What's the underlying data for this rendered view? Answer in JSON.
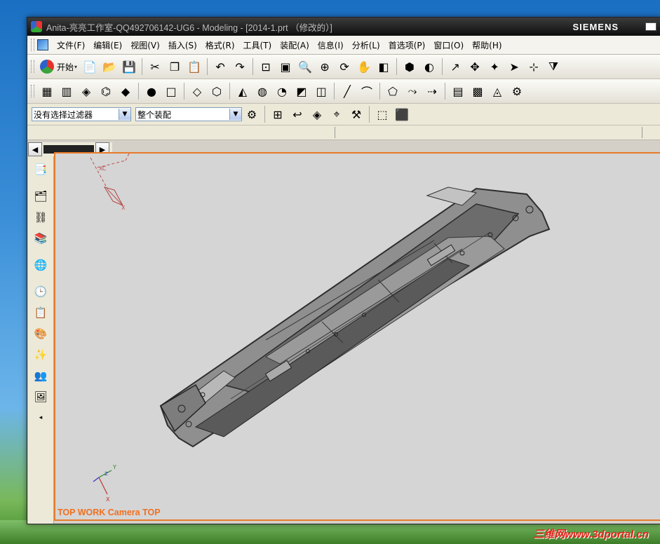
{
  "window": {
    "title": "Anita-亮亮工作室-QQ492706142-UG6 - Modeling - [2014-1.prt （修改的）]",
    "brand": "SIEMENS"
  },
  "menu": [
    {
      "label": "文件(F)"
    },
    {
      "label": "编辑(E)"
    },
    {
      "label": "视图(V)"
    },
    {
      "label": "插入(S)"
    },
    {
      "label": "格式(R)"
    },
    {
      "label": "工具(T)"
    },
    {
      "label": "装配(A)"
    },
    {
      "label": "信息(I)"
    },
    {
      "label": "分析(L)"
    },
    {
      "label": "首选项(P)"
    },
    {
      "label": "窗口(O)"
    },
    {
      "label": "帮助(H)"
    }
  ],
  "toolbar": {
    "start_label": "开始",
    "icons_row1": [
      "new-file-icon",
      "open-folder-icon",
      "save-icon",
      "cut-icon",
      "copy-icon",
      "paste-icon",
      "undo-icon",
      "redo-icon",
      "fit-view-icon",
      "zoom-window-icon",
      "zoom-icon",
      "zoom-in-icon",
      "rotate-icon",
      "pan-icon",
      "perspective-icon",
      "shaded-view-icon",
      "render-style-icon",
      "wcs-icon",
      "move-icon",
      "snap-icon",
      "select-icon",
      "point-icon",
      "filter-icon"
    ],
    "icons_row2": [
      "sketch-icon",
      "datum-plane-icon",
      "extrude-icon",
      "revolve-icon",
      "sweep-icon",
      "hole-icon",
      "boss-icon",
      "block-icon",
      "cylinder-icon",
      "cone-icon",
      "sphere-icon",
      "blend-icon",
      "chamfer-icon",
      "shell-icon",
      "line-icon",
      "arc-icon",
      "spline-icon",
      "curve-icon",
      "offset-icon",
      "surface-icon",
      "mesh-icon",
      "trim-icon",
      "analysis-icon"
    ]
  },
  "filter": {
    "selection_filter": "没有选择过滤器",
    "assembly_scope": "整个装配"
  },
  "resource_bar": [
    "part-navigator-icon",
    "assembly-navigator-icon",
    "constraint-navigator-icon",
    "reuse-library-icon",
    "web-browser-icon",
    "history-icon",
    "process-studio-icon",
    "palette-icon",
    "roles-icon",
    "system-materials-icon",
    "image-icon"
  ],
  "graphics": {
    "view_label": "TOP WORK Camera TOP",
    "wcs_label": "XC",
    "axis_x": "X",
    "axis_y": "Y",
    "axis_z": "Z"
  },
  "desktop": {
    "watermark": "三维网www.3dportal.cn"
  },
  "colors": {
    "accent": "#e87a2a",
    "model": "#5a5a5a",
    "viewport": "#d5d5d5"
  }
}
